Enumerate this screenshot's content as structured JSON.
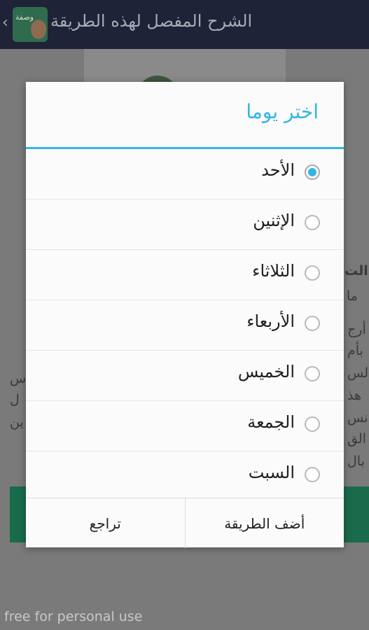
{
  "app_bar": {
    "title": "الشرح المفصل لهذه الطريقة",
    "icon_text": "وصفة"
  },
  "background_text": {
    "line1": "الت",
    "line2": "ما",
    "line3": "أرج",
    "line4": "بأم",
    "line5": "الس",
    "line6": "هذ",
    "line7": "نس",
    "line8": "الق",
    "line9": "بال",
    "left1": "س",
    "left2": "ل",
    "left3": "ين"
  },
  "dialog": {
    "title": "اختر يوما",
    "options": [
      {
        "label": "الأحد",
        "checked": true
      },
      {
        "label": "الإثنين",
        "checked": false
      },
      {
        "label": "الثلاثاء",
        "checked": false
      },
      {
        "label": "الأربعاء",
        "checked": false
      },
      {
        "label": "الخميس",
        "checked": false
      },
      {
        "label": "الجمعة",
        "checked": false
      },
      {
        "label": "السبت",
        "checked": false
      }
    ],
    "buttons": {
      "add": "أضف الطريقة",
      "back": "تراجع"
    }
  },
  "watermark": "free for personal use",
  "colors": {
    "accent": "#33b5e5",
    "app_bar": "#1f2338",
    "scrim": "#7a7a7a"
  }
}
